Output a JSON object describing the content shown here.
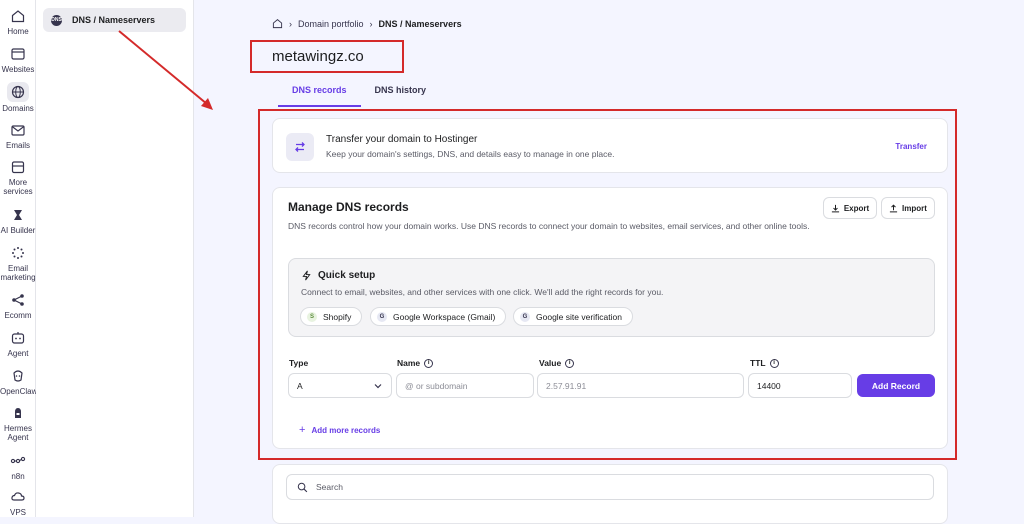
{
  "rail": [
    {
      "label": "Home",
      "icon": "home-icon"
    },
    {
      "label": "Websites",
      "icon": "websites-icon"
    },
    {
      "label": "Domains",
      "icon": "globe-icon",
      "active": true
    },
    {
      "label": "Emails",
      "icon": "mail-icon"
    },
    {
      "label": "More services",
      "label1": "More",
      "label2": "services",
      "icon": "store-icon"
    },
    {
      "label": "AI Builder",
      "icon": "ai-builder-icon"
    },
    {
      "label": "Email marketing",
      "label1": "Email",
      "label2": "marketing",
      "icon": "email-marketing-icon"
    },
    {
      "label": "Ecomm",
      "icon": "share-icon"
    },
    {
      "label": "Agent",
      "icon": "agent-icon"
    },
    {
      "label": "OpenClaw",
      "icon": "openclaw-icon"
    },
    {
      "label": "Hermes Agent",
      "label1": "Hermes",
      "label2": "Agent",
      "icon": "hermes-icon"
    },
    {
      "label": "n8n",
      "icon": "n8n-icon"
    },
    {
      "label": "VPS",
      "icon": "vps-icon"
    }
  ],
  "subnav": {
    "label": "DNS / Nameservers"
  },
  "breadcrumb": {
    "item1": "Domain portfolio",
    "item2": "DNS / Nameservers"
  },
  "domain": "metawingz.co",
  "tabs": [
    {
      "label": "DNS records",
      "active": true
    },
    {
      "label": "DNS history",
      "active": false
    }
  ],
  "transfer": {
    "title": "Transfer your domain to Hostinger",
    "description": "Keep your domain's settings, DNS, and details easy to manage in one place.",
    "link": "Transfer"
  },
  "dns": {
    "title": "Manage DNS records",
    "description": "DNS records control how your domain works. Use DNS records to connect your domain to websites, email services, and other online tools.",
    "export_label": "Export",
    "import_label": "Import",
    "quick_setup": {
      "title": "Quick setup",
      "description": "Connect to email, websites, and other services with one click. We'll add the right records for you.",
      "chips": [
        "Shopify",
        "Google Workspace (Gmail)",
        "Google site verification"
      ]
    },
    "form": {
      "type_label": "Type",
      "type_value": "A",
      "name_label": "Name",
      "name_placeholder": "@ or subdomain",
      "value_label": "Value",
      "value_value": "2.57.91.91",
      "ttl_label": "TTL",
      "ttl_value": "14400",
      "add_button": "Add Record"
    },
    "add_more": "Add more records"
  },
  "search": {
    "placeholder": "Search"
  },
  "colors": {
    "accent": "#673de6",
    "annotation_red": "#d42a2a"
  }
}
